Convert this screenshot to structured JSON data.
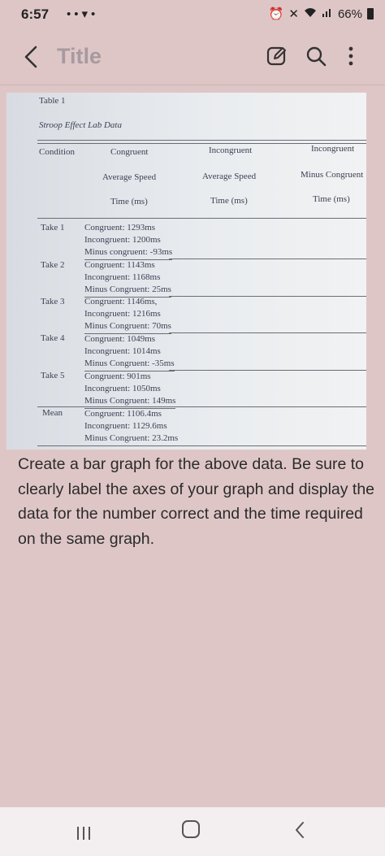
{
  "status_bar": {
    "time": "6:57",
    "left_icons": "••▾•",
    "battery": "66%"
  },
  "app_bar": {
    "title": "Title"
  },
  "photo": {
    "table_label": "Table 1",
    "table_title": "Stroop Effect Lab Data",
    "headers": {
      "condition": "Condition",
      "congruent": "Congruent",
      "incongruent": "Incongruent",
      "incongruent2": "Incongruent",
      "avg_speed_1": "Average Speed",
      "avg_speed_2": "Average Speed",
      "minus_congruent": "Minus Congruent",
      "time_1": "Time (ms)",
      "time_2": "Time (ms)",
      "time_3": "Time (ms)"
    },
    "rows": [
      {
        "label": "Take 1",
        "lines": [
          "Congruent: 1293ms",
          "Incongruent: 1200ms",
          "Minus congruent: -93ms"
        ]
      },
      {
        "label": "Take 2",
        "lines": [
          "Congruent: 1143ms",
          "Incongruent: 1168ms",
          "Minus Congruent: 25ms"
        ]
      },
      {
        "label": "Take 3",
        "lines": [
          "Congruent: 1146ms,",
          "Incongruent: 1216ms",
          "Minus Congruent: 70ms"
        ]
      },
      {
        "label": "Take 4",
        "lines": [
          "Congruent: 1049ms",
          "Incongruent: 1014ms",
          "Minus Congruent: -35ms"
        ]
      },
      {
        "label": "Take 5",
        "lines": [
          "Congruent: 901ms",
          "Incongruent: 1050ms",
          "Minus Congruent: 149ms"
        ]
      },
      {
        "label": "Mean",
        "lines": [
          "Congruent: 1106.4ms",
          "Incongruent: 1129.6ms",
          "Minus Congruent: 23.2ms"
        ]
      }
    ]
  },
  "question": "Create a bar graph for the above data. Be sure to clearly label the axes of your graph and display the data for the number correct and the time required on the same graph."
}
